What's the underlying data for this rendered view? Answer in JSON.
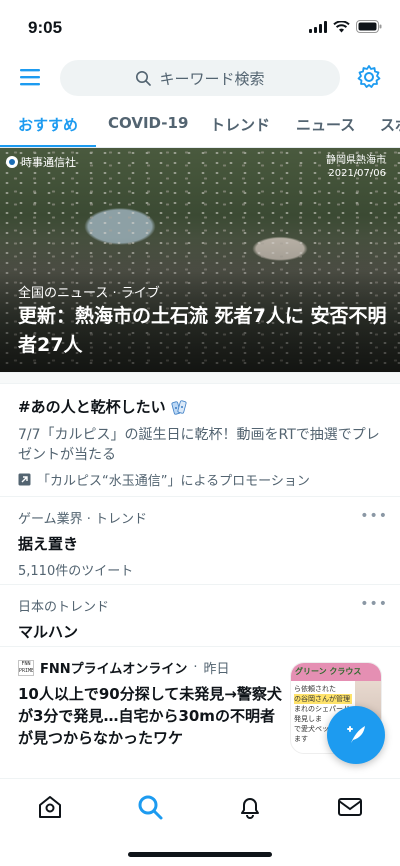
{
  "status_bar": {
    "time": "9:05"
  },
  "search": {
    "placeholder": "キーワード検索"
  },
  "tabs": [
    {
      "label": "おすすめ",
      "active": true
    },
    {
      "label": "COVID-19"
    },
    {
      "label": "トレンド"
    },
    {
      "label": "ニュース"
    },
    {
      "label": "スポ"
    }
  ],
  "hero": {
    "logo_text": "時事通信社",
    "stamp_place": "静岡県熱海市",
    "stamp_date": "2021/07/06",
    "category": "全国のニュース · ライブ",
    "title": "更新：熱海市の土石流 死者7人に 安否不明者27人"
  },
  "promo": {
    "title": "#あの人と乾杯したい",
    "description": "7/7「カルピス」の誕生日に乾杯！動画をRTで抽選でプレゼントが当たる",
    "promoted_by": "「カルピス“水玉通信”」によるプロモーション"
  },
  "trends": [
    {
      "category": "ゲーム業界 · トレンド",
      "name": "据え置き",
      "count": "5,110件のツイート"
    },
    {
      "category": "日本のトレンド",
      "name": "マルハン",
      "count": ""
    }
  ],
  "news": {
    "source": "FNNプライムオンライン",
    "time": "昨日",
    "badge": "FNN PRIME",
    "title": "10人以上で90分探して未発見→警察犬が3分で発見…自宅から30mの不明者が見つからなかったワケ",
    "thumb_banner": "グリーン クラウス",
    "thumb_lines": [
      "ら依頼された",
      "の谷岡さんが管理",
      "まれのシェパード",
      "発見しま",
      "で愛犬ペットの",
      "ます"
    ]
  },
  "colors": {
    "accent": "#1d9bf0",
    "text": "#0f1419",
    "muted": "#536471"
  },
  "icons": [
    "menu-icon",
    "search-icon",
    "gear-icon",
    "home-icon",
    "bell-icon",
    "mail-icon",
    "compose-icon"
  ]
}
